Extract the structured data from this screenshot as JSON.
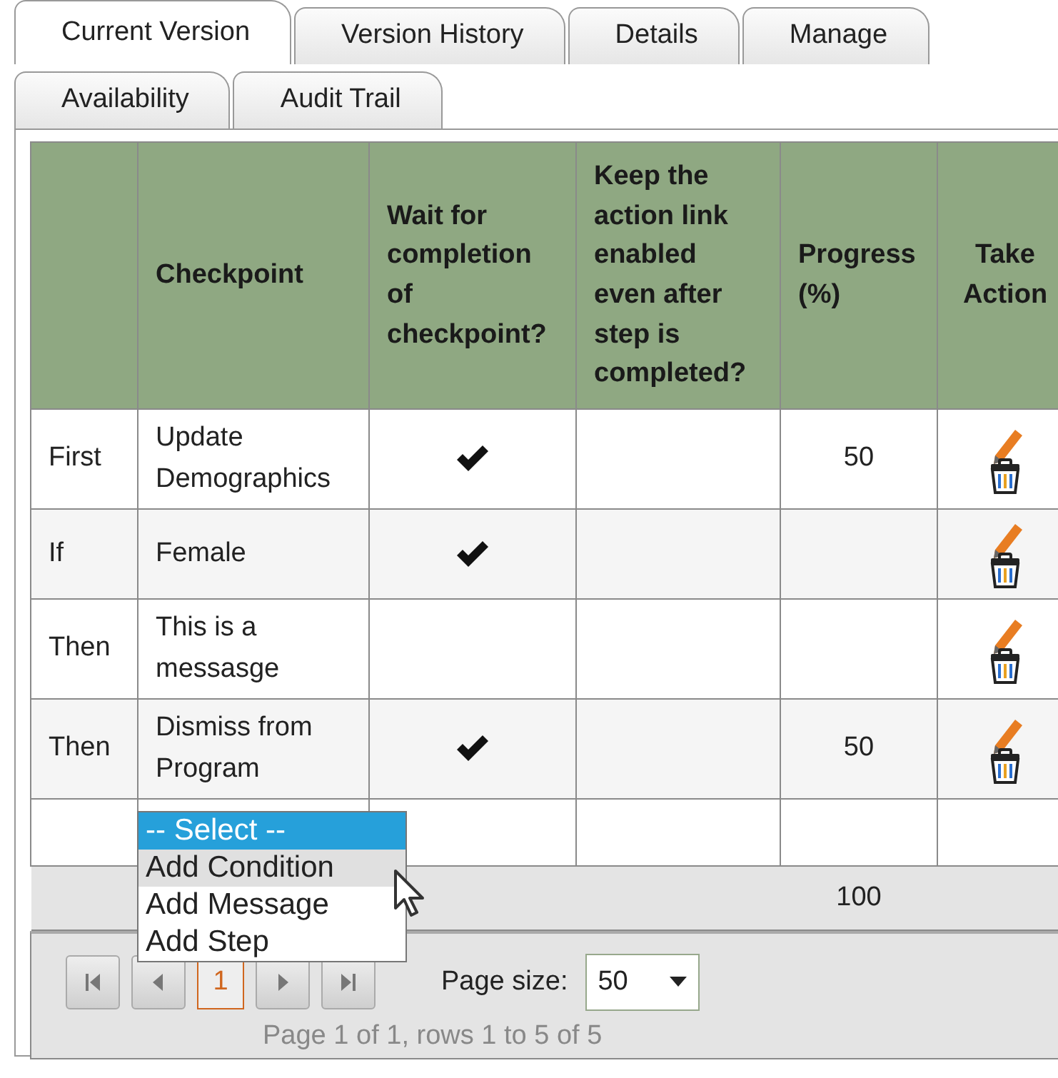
{
  "tab_rows": [
    [
      {
        "label": "Current Version",
        "selected": true
      },
      {
        "label": "Version History",
        "selected": false
      },
      {
        "label": "Details",
        "selected": false
      },
      {
        "label": "Manage",
        "selected": false
      }
    ],
    [
      {
        "label": "Availability",
        "selected": false
      },
      {
        "label": "Audit Trail",
        "selected": false
      }
    ]
  ],
  "table": {
    "columns": [
      "Checkpoint",
      "Wait for completion of checkpoint?",
      "Keep the action link enabled even after step is completed?",
      "Progress (%)",
      "Take Action"
    ],
    "rows": [
      {
        "step": "First",
        "checkpoint": "Update Demographics",
        "wait": true,
        "progress": "50"
      },
      {
        "step": "If",
        "checkpoint": "Female",
        "wait": true
      },
      {
        "step": "Then",
        "checkpoint": "This is a messasge",
        "wait": false
      },
      {
        "step": "Then",
        "checkpoint": "Dismiss from Program",
        "wait": true,
        "progress": "50"
      }
    ],
    "new_row": {
      "options": [
        {
          "label": "-- Select --",
          "selected": true,
          "hovered": false
        },
        {
          "label": "Add Condition",
          "selected": false,
          "hovered": true
        },
        {
          "label": "Add Message",
          "selected": false,
          "hovered": false
        },
        {
          "label": "Add Step",
          "selected": false,
          "hovered": false
        }
      ]
    },
    "footer": {
      "progress_total": "100"
    }
  },
  "pager": {
    "current_page": "1",
    "page_size_label": "Page size:",
    "page_size": "50",
    "info": "Page 1 of 1, rows 1 to 5 of 5"
  }
}
